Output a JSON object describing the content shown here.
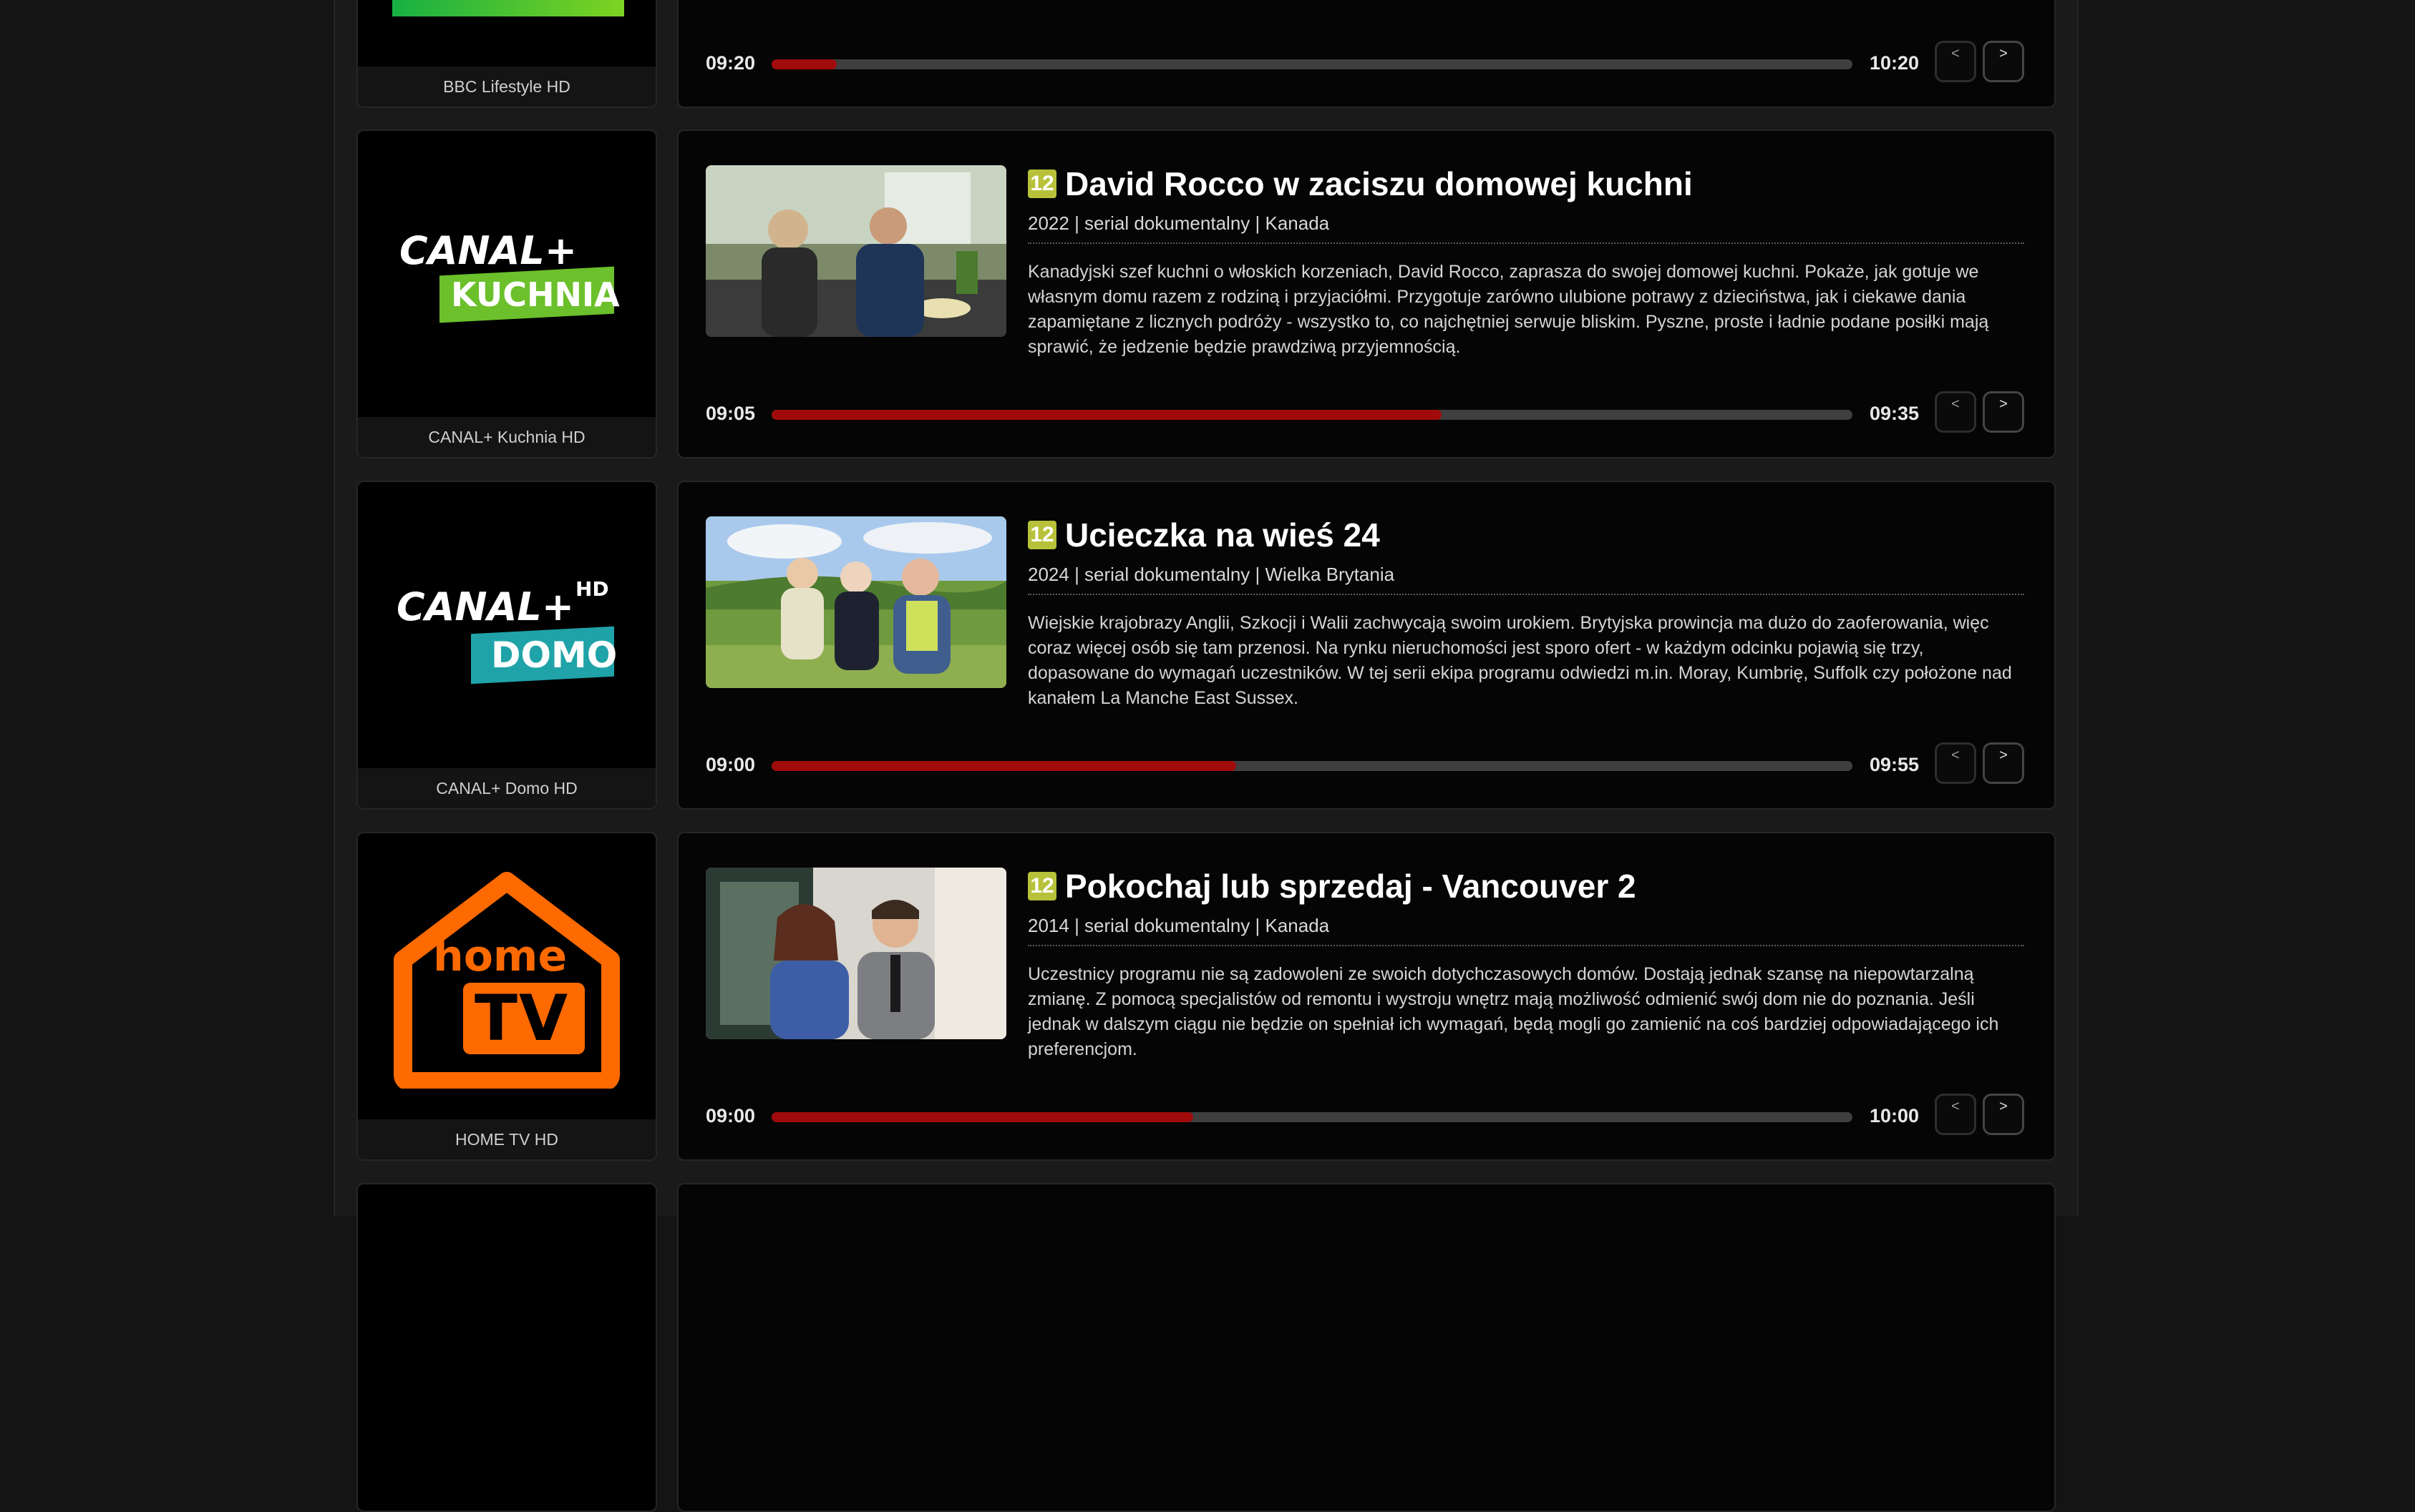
{
  "rows": [
    {
      "channel": {
        "name": "BBC Lifestyle HD",
        "logo_icon": "bbc-lifestyle-logo"
      },
      "program": {
        "start": "09:20",
        "end": "10:20",
        "progress": 0.06,
        "prev_label": "<",
        "next_label": ">"
      }
    },
    {
      "channel": {
        "name": "CANAL+ Kuchnia HD",
        "logo_icon": "canal-plus-kuchnia-logo",
        "logo_line1": "CANAL+",
        "logo_line2": "KUCHNIA"
      },
      "program": {
        "age_rating": "12",
        "title": "David Rocco w zaciszu domowej kuchni",
        "meta": "2022 | serial dokumentalny | Kanada",
        "description": "Kanadyjski szef kuchni o włoskich korzeniach, David Rocco, zaprasza do swojej domowej kuchni. Pokaże, jak gotuje we własnym domu razem z rodziną i przyjaciółmi. Przygotuje zarówno ulubione potrawy z dzieciństwa, jak i ciekawe dania zapamiętane z licznych podróży - wszystko to, co najchętniej serwuje bliskim. Pyszne, proste i ładnie podane posiłki mają sprawić, że jedzenie będzie prawdziwą przyjemnością.",
        "start": "09:05",
        "end": "09:35",
        "progress": 0.62,
        "prev_label": "<",
        "next_label": ">"
      }
    },
    {
      "channel": {
        "name": "CANAL+ Domo HD",
        "logo_icon": "canal-plus-domo-logo",
        "logo_line1": "CANAL+",
        "logo_hd": "HD",
        "logo_line2": "DOMO"
      },
      "program": {
        "age_rating": "12",
        "title": "Ucieczka na wieś 24",
        "meta": "2024 | serial dokumentalny | Wielka Brytania",
        "description": "Wiejskie krajobrazy Anglii, Szkocji i Walii zachwycają swoim urokiem. Brytyjska prowincja ma dużo do zaoferowania, więc coraz więcej osób się tam przenosi. Na rynku nieruchomości jest sporo ofert - w każdym odcinku pojawią się trzy, dopasowane do wymagań uczestników. W tej serii ekipa programu odwiedzi m.in. Moray, Kumbrię, Suffolk czy położone nad kanałem La Manche East Sussex.",
        "start": "09:00",
        "end": "09:55",
        "progress": 0.43,
        "prev_label": "<",
        "next_label": ">"
      }
    },
    {
      "channel": {
        "name": "HOME TV HD",
        "logo_icon": "home-tv-logo",
        "logo_line1": "home",
        "logo_line2": "TV"
      },
      "program": {
        "age_rating": "12",
        "title": "Pokochaj lub sprzedaj - Vancouver 2",
        "meta": "2014 | serial dokumentalny | Kanada",
        "description": "Uczestnicy programu nie są zadowoleni ze swoich dotychczasowych domów. Dostają jednak szansę na niepowtarzalną zmianę. Z pomocą specjalistów od remontu i wystroju wnętrz mają możliwość odmienić swój dom nie do poznania. Jeśli jednak w dalszym ciągu nie będzie on spełniał ich wymagań, będą mogli go zamienić na coś bardziej odpowiadającego ich preferencjom.",
        "start": "09:00",
        "end": "10:00",
        "progress": 0.39,
        "prev_label": "<",
        "next_label": ">"
      }
    }
  ],
  "colors": {
    "accent_red": "#a10b0b",
    "age_badge": "#b7c23a",
    "kuchnia_green": "#6cc02b",
    "domo_teal": "#1fa3a8",
    "home_orange": "#ff6a00"
  }
}
